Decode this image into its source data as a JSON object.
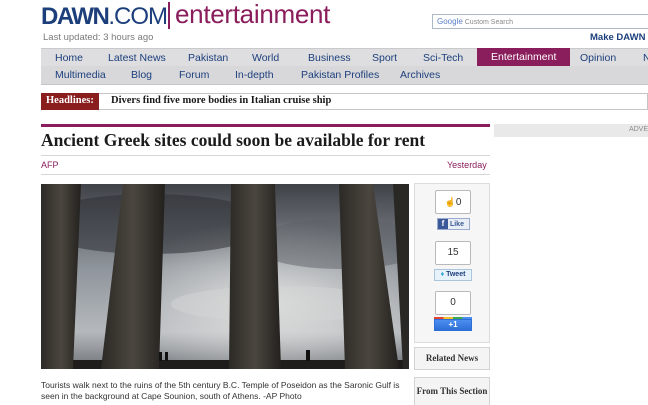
{
  "brand": {
    "name_bold": "DAWN",
    "name_com": ".COM",
    "section": "entertainment"
  },
  "last_updated": "Last updated: 3 hours ago",
  "search": {
    "google": "Google",
    "placeholder": "Custom Search"
  },
  "make_link": "Make DAWN y",
  "nav_primary": [
    "Home",
    "Latest News",
    "Pakistan",
    "World",
    "Business",
    "Sport",
    "Sci-Tech",
    "Entertainment",
    "Opinion",
    "N"
  ],
  "nav_secondary": [
    "Multimedia",
    "Blog",
    "Forum",
    "In-depth",
    "Pakistan Profiles",
    "Archives"
  ],
  "headlines": {
    "label": "Headlines:",
    "text": "Divers find five more bodies in Italian cruise ship"
  },
  "ad_label": "ADVE",
  "article": {
    "title": "Ancient Greek sites could soon be available for rent",
    "source": "AFP",
    "date": "Yesterday",
    "caption": "Tourists walk next to the ruins of the 5th century B.C. Temple of Poseidon as the Saronic Gulf is seen in the background at Cape Sounion, south of Athens. -AP Photo"
  },
  "share": {
    "fb_count": "0",
    "fb_label": "Like",
    "tweet_count": "15",
    "tweet_label": "Tweet",
    "plus_count": "0",
    "plus_label": "+1"
  },
  "sidebar": {
    "related": "Related News",
    "from_section": "From This Section"
  },
  "colors": {
    "brand_blue": "#1c3f7c",
    "accent": "#8a1d5b",
    "headline_red": "#8a1d1d"
  }
}
